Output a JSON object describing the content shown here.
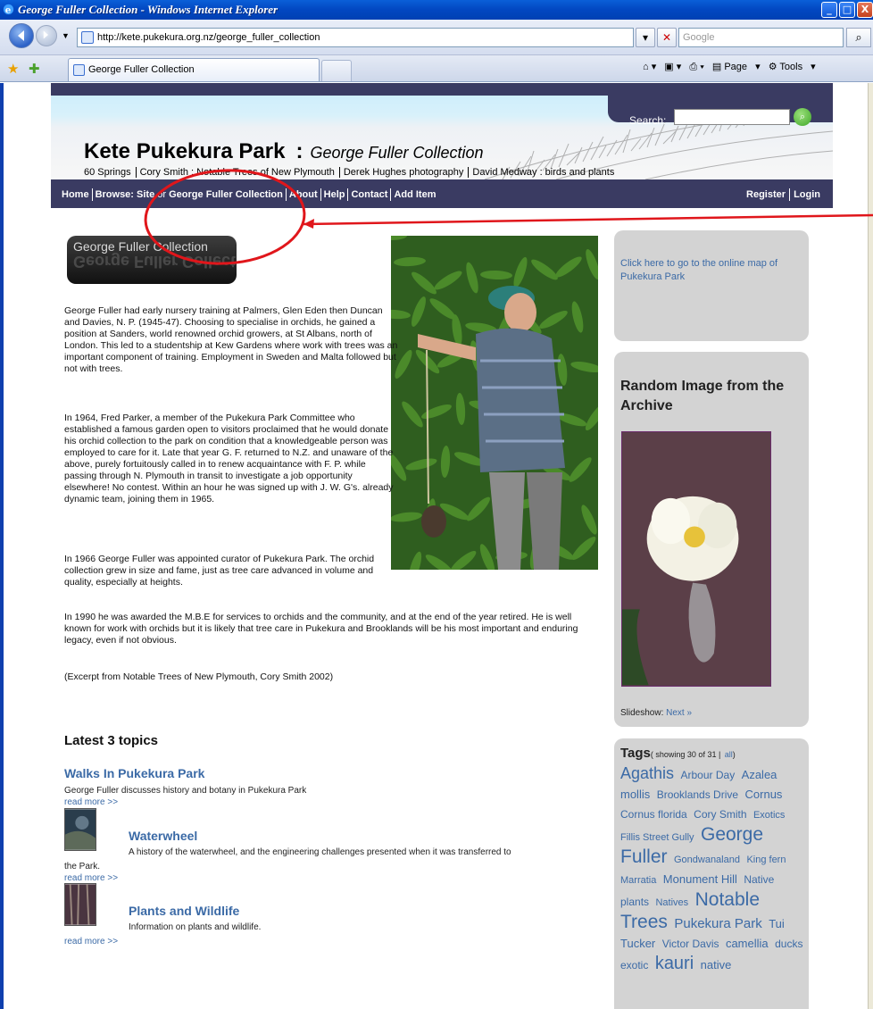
{
  "window": {
    "title": "George Fuller Collection - Windows Internet Explorer",
    "minimize": "_",
    "maximize": "□",
    "close": "X"
  },
  "address_bar": {
    "url": "http://kete.pukekura.org.nz/george_fuller_collection",
    "search_placeholder": "Google"
  },
  "tabs": [
    {
      "label": "George Fuller Collection",
      "active": true
    }
  ],
  "command_bar": {
    "page_label": "Page",
    "tools_label": "Tools"
  },
  "site": {
    "search_label": "Search:",
    "title": "Kete Pukekura Park",
    "colon": ":",
    "subtitle": "George Fuller Collection",
    "basket_links": [
      "60 Springs",
      "Cory Smith : Notable Trees of New Plymouth",
      "Derek Hughes photography",
      "David Medway : birds and plants"
    ],
    "nav": {
      "home": "Home",
      "browse": "Browse:",
      "site": "Site",
      "or": "or",
      "collection": "George Fuller Collection",
      "about": "About",
      "help": "Help",
      "contact": "Contact",
      "add_item": "Add Item",
      "register": "Register",
      "login": "Login"
    },
    "logo_text": "George Fuller Collection",
    "paragraphs": [
      "George Fuller had early nursery training at Palmers, Glen Eden then Duncan and Davies, N. P. (1945-47). Choosing to specialise in orchids, he gained a position at Sanders, world renowned orchid growers, at St Albans, north of London. This led to a studentship at Kew Gardens where work with trees was an important component of training. Employment in Sweden and Malta followed but not with trees.",
      "In 1964, Fred Parker, a member of the Pukekura Park Committee who established a famous garden open to visitors proclaimed that he would donate his orchid collection to the park on condition that a knowledgeable person was employed to care for it. Late that year G. F. returned to N.Z. and unaware of the above, purely fortuitously called in to renew acquaintance with F. P. while passing through N. Plymouth in transit to investigate a job opportunity elsewhere! No contest. Within an hour he was signed up with J. W. G's. already dynamic team, joining them in 1965.",
      "In 1966 George Fuller was appointed curator of Pukekura Park. The orchid collection grew in size and fame, just as tree care advanced in volume and quality, especially at heights.",
      "In 1990 he was awarded the M.B.E for services to orchids and the community, and at the end of the year retired. He is well known for work with orchids but it is likely that tree care in Pukekura and Brooklands will be his most important and enduring legacy, even if not obvious.",
      "(Excerpt from Notable Trees of New Plymouth, Cory Smith 2002)"
    ],
    "latest_heading": "Latest 3 topics",
    "topics": [
      {
        "title": "Walks In Pukekura Park",
        "desc": "George Fuller discusses history and botany in Pukekura Park",
        "more": "read more >>"
      },
      {
        "title": "Waterwheel",
        "desc": "A history of the waterwheel, and the engineering challenges presented when it was transferred to",
        "desc2": "the Park.",
        "more": "read more >>"
      },
      {
        "title": "Plants and Wildlife",
        "desc": "Information on plants and wildlife.",
        "more": "read more >>"
      }
    ],
    "sidebar": {
      "map_link": "Click here to go to the online map of Pukekura Park",
      "random_heading": "Random Image from the Archive",
      "slideshow_label": "Slideshow:",
      "slideshow_next": "Next »",
      "tags_heading": "Tags",
      "tags_count_pre": "( showing 30 of 31 |",
      "tags_all": "all",
      "tags_count_post": ")",
      "tags": [
        {
          "t": "Agathis",
          "s": 18
        },
        {
          "t": "Arbour Day",
          "s": 12
        },
        {
          "t": "Azalea mollis",
          "s": 13
        },
        {
          "t": "Brooklands Drive",
          "s": 12
        },
        {
          "t": "Cornus",
          "s": 13
        },
        {
          "t": "Cornus florida",
          "s": 12
        },
        {
          "t": "Cory Smith",
          "s": 12
        },
        {
          "t": "Exotics",
          "s": 11
        },
        {
          "t": "Fillis Street Gully",
          "s": 11
        },
        {
          "t": "George Fuller",
          "s": 21
        },
        {
          "t": "Gondwanaland",
          "s": 11
        },
        {
          "t": "King fern",
          "s": 11
        },
        {
          "t": "Marratia",
          "s": 11
        },
        {
          "t": "Monument Hill",
          "s": 13
        },
        {
          "t": "Native plants",
          "s": 12
        },
        {
          "t": "Natives",
          "s": 11
        },
        {
          "t": "Notable Trees",
          "s": 21
        },
        {
          "t": "Pukekura Park",
          "s": 15
        },
        {
          "t": "Tui Tucker",
          "s": 13
        },
        {
          "t": "Victor Davis",
          "s": 12
        },
        {
          "t": "camellia",
          "s": 13
        },
        {
          "t": "ducks",
          "s": 12
        },
        {
          "t": "exotic",
          "s": 12
        },
        {
          "t": "kauri",
          "s": 20
        },
        {
          "t": "native",
          "s": 13
        }
      ]
    }
  },
  "colors": {
    "site_nav": "#3a3b62",
    "link": "#3b6aa6",
    "annotation": "#e0161b"
  }
}
